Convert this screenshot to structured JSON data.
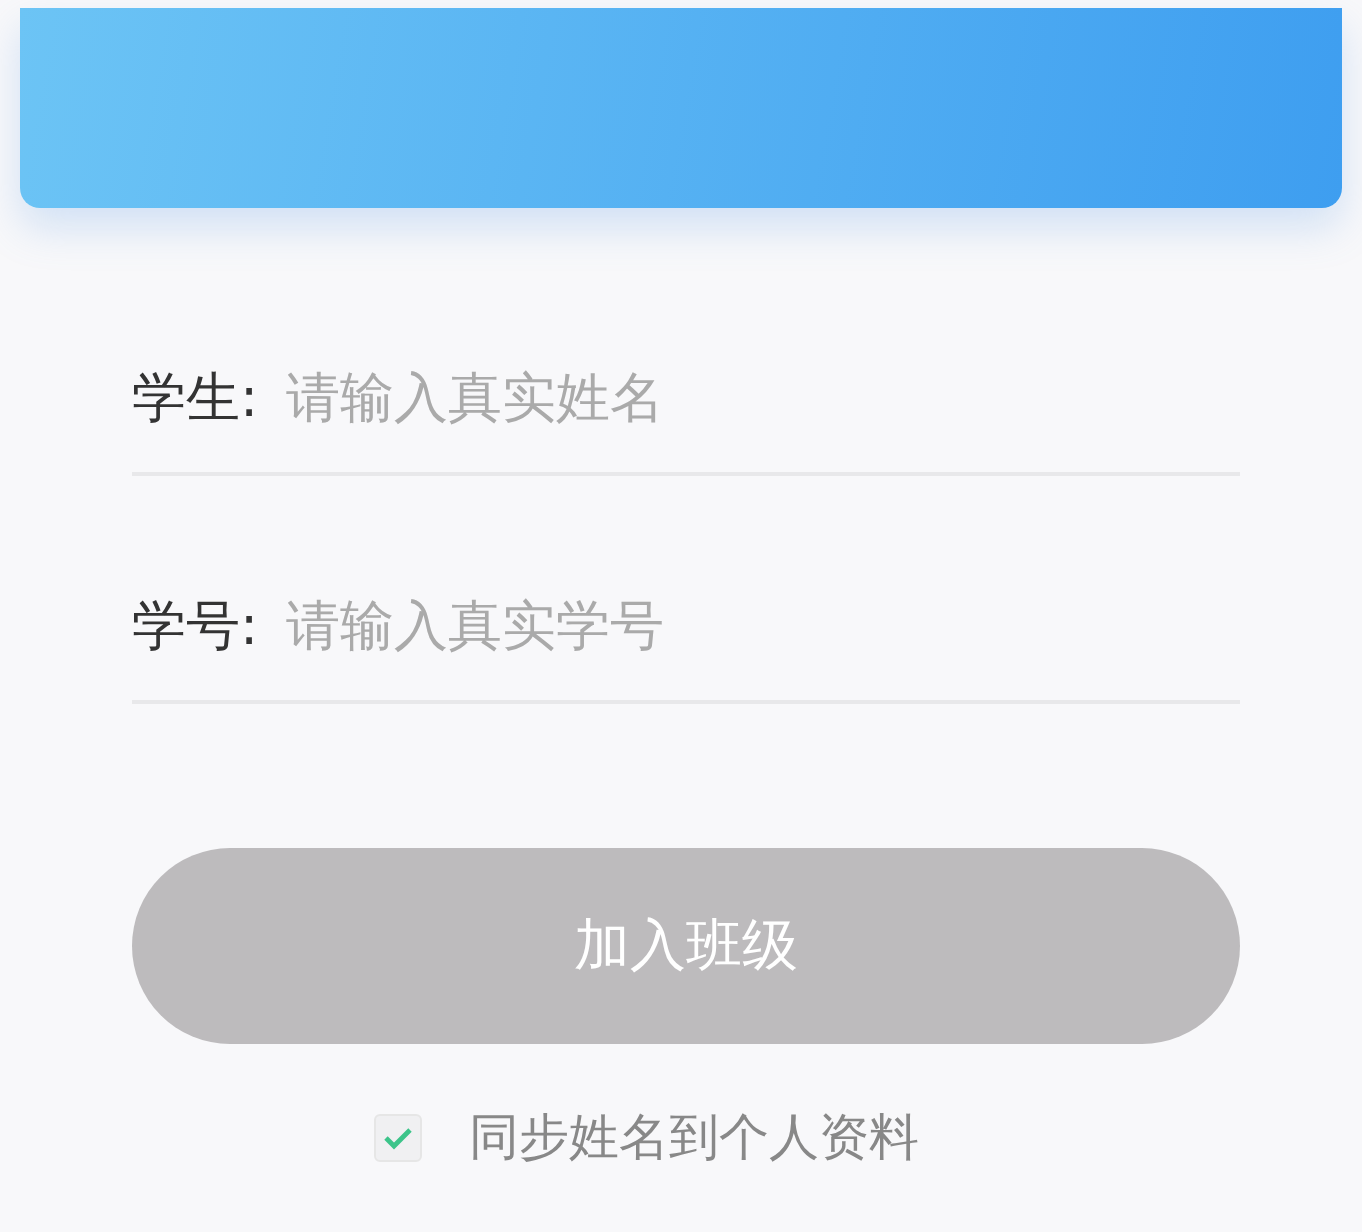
{
  "fields": [
    {
      "label": "学生:",
      "placeholder": "请输入真实姓名"
    },
    {
      "label": "学号:",
      "placeholder": "请输入真实学号"
    }
  ],
  "join_button": {
    "label": "加入班级",
    "disabled": true
  },
  "sync_option": {
    "label": "同步姓名到个人资料",
    "checked": true
  }
}
